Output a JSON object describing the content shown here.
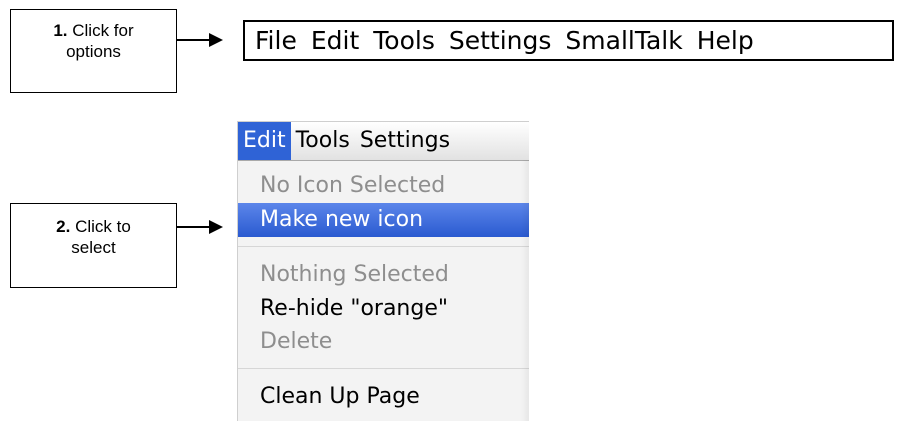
{
  "callouts": [
    {
      "number": "1.",
      "text_line1": "Click for",
      "text_line2": "options"
    },
    {
      "number": "2.",
      "text_line1": "Click to",
      "text_line2": "select"
    }
  ],
  "menubar": {
    "titles": [
      "File",
      "Edit",
      "Tools",
      "Settings",
      "SmallTalk",
      "Help"
    ]
  },
  "edit_menu": {
    "bar_titles": [
      "Edit",
      "Tools",
      "Settings"
    ],
    "active_title": "Edit",
    "items": [
      {
        "label": "No Icon Selected",
        "enabled": false
      },
      {
        "label": "Make new icon",
        "enabled": true,
        "highlighted": true
      },
      {
        "label": "Nothing Selected",
        "enabled": false
      },
      {
        "label": "Re-hide \"orange\"",
        "enabled": true
      },
      {
        "label": "Delete",
        "enabled": false
      },
      {
        "label": "Clean Up Page",
        "enabled": true
      }
    ]
  },
  "colors": {
    "highlight": "#2f63d6",
    "disabled_text": "#8e8e8e"
  }
}
